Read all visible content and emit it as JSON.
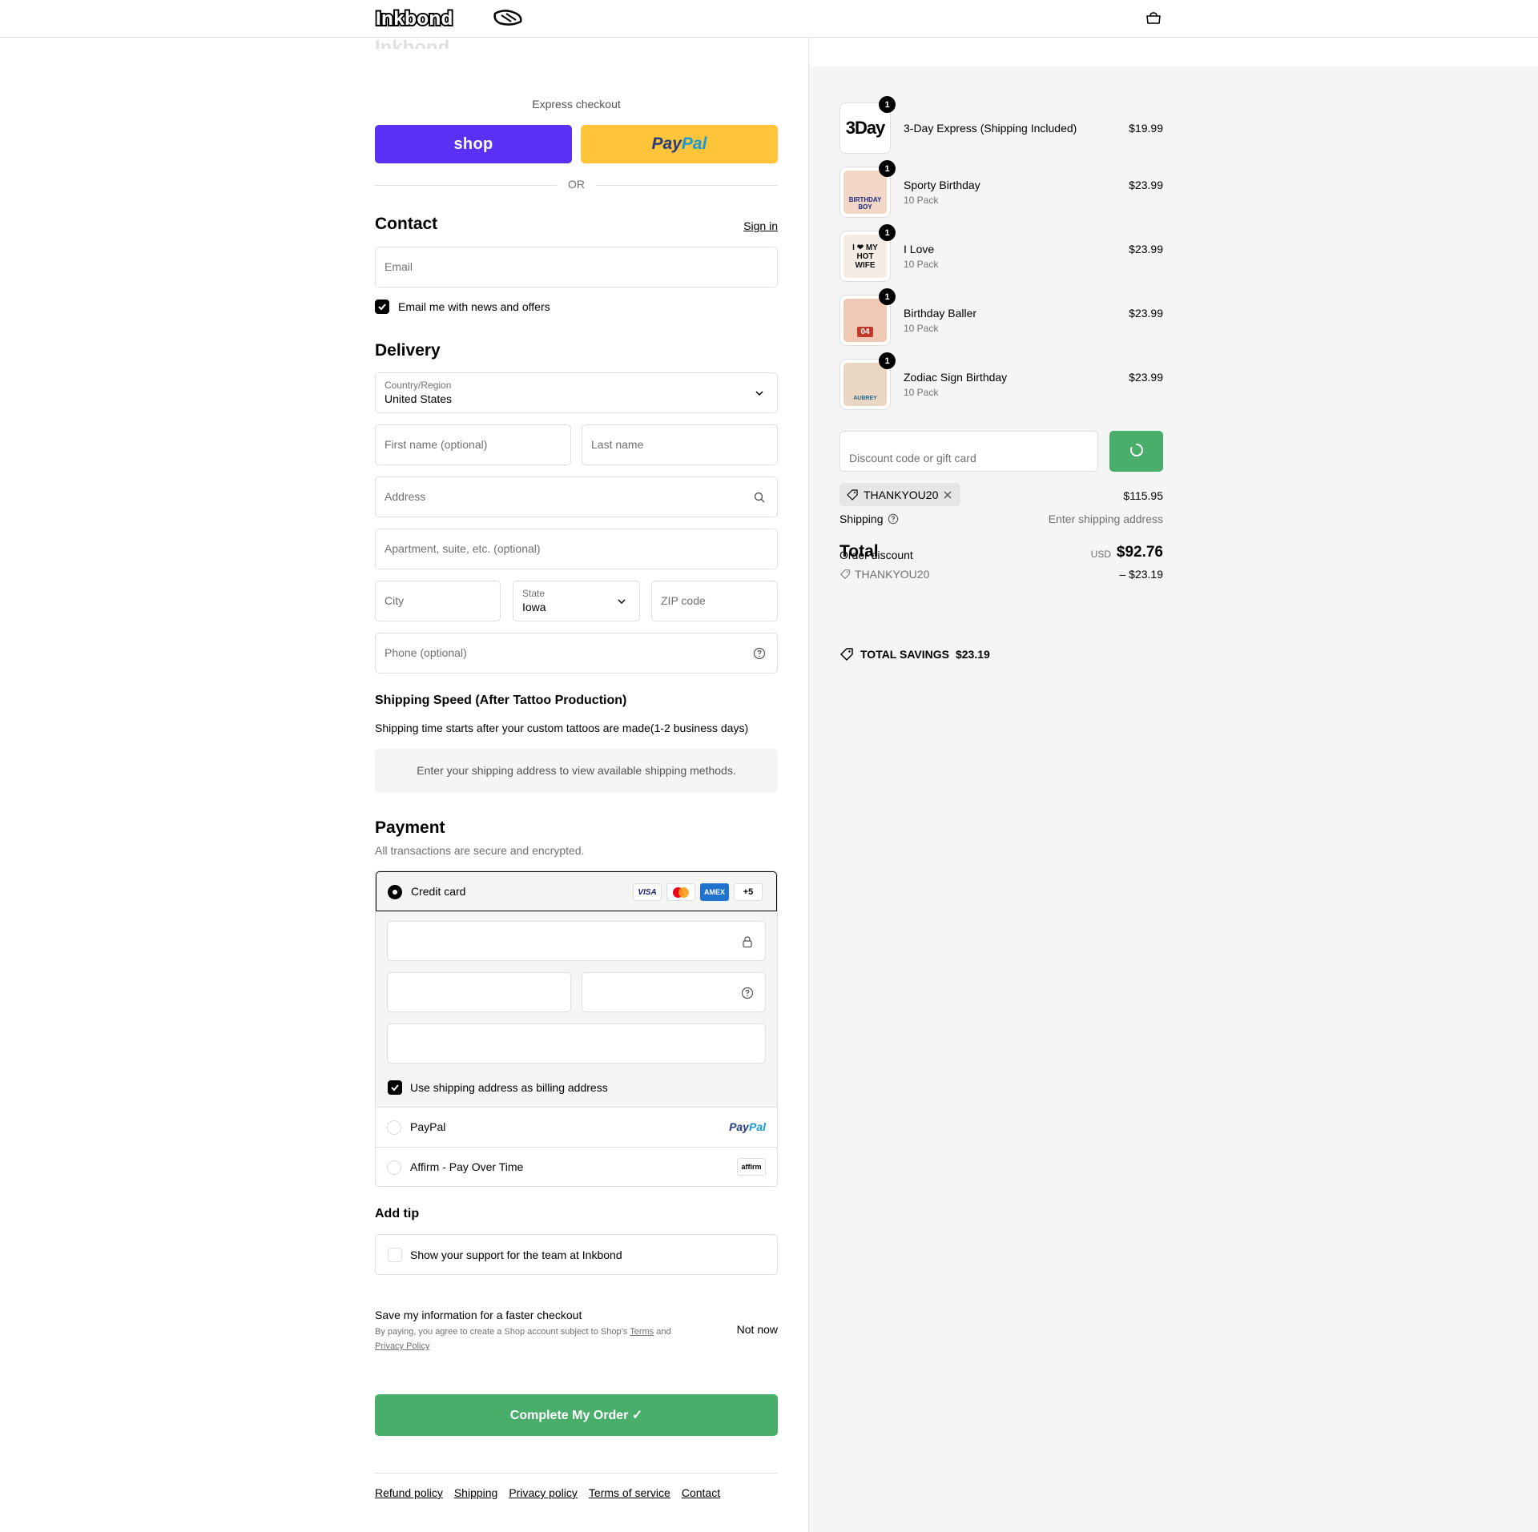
{
  "header": {
    "logo_text": "Inkbond",
    "cart_icon": "cart-icon"
  },
  "express": {
    "label": "Express checkout",
    "shop_label": "shop",
    "paypal_label_a": "Pay",
    "paypal_label_b": "Pal",
    "or_label": "OR"
  },
  "contact": {
    "title": "Contact",
    "sign_in": "Sign in",
    "email_placeholder": "Email",
    "news_label": "Email me with news and offers",
    "news_checked": true
  },
  "delivery": {
    "title": "Delivery",
    "country_label": "Country/Region",
    "country_value": "United States",
    "first_name_placeholder": "First name (optional)",
    "last_name_placeholder": "Last name",
    "address_placeholder": "Address",
    "apartment_placeholder": "Apartment, suite, etc. (optional)",
    "city_placeholder": "City",
    "state_label": "State",
    "state_value": "Iowa",
    "zip_placeholder": "ZIP code",
    "phone_placeholder": "Phone (optional)"
  },
  "shipping_speed": {
    "title": "Shipping Speed (After Tattoo Production)",
    "description": "Shipping time starts after your custom tattoos are made(1-2 business days)",
    "notice": "Enter your shipping address to view available shipping methods."
  },
  "payment": {
    "title": "Payment",
    "subtitle": "All transactions are secure and encrypted.",
    "credit_card_label": "Credit card",
    "card_logos": [
      "VISA",
      "MC",
      "AMEX",
      "+5"
    ],
    "billing_label": "Use shipping address as billing address",
    "paypal_label": "PayPal",
    "paypal_logo_a": "Pay",
    "paypal_logo_b": "Pal",
    "affirm_label": "Affirm - Pay Over Time",
    "affirm_logo": "affirm"
  },
  "tip": {
    "title": "Add tip",
    "label": "Show your support for the team at Inkbond"
  },
  "save_info": {
    "title": "Save my information for a faster checkout",
    "desc_a": "By paying, you agree to create a Shop account subject to Shop’s ",
    "terms": "Terms",
    "desc_b": " and ",
    "privacy": "Privacy Policy",
    "not_now": "Not now"
  },
  "complete_button": "Complete My Order ✓",
  "footer": {
    "links": [
      "Refund policy",
      "Shipping",
      "Privacy policy",
      "Terms of service",
      "Contact"
    ]
  },
  "summary": {
    "items": [
      {
        "name": "3-Day Express (Shipping Included)",
        "variant": "",
        "price": "$19.99",
        "qty": "1",
        "thumb": "3Day"
      },
      {
        "name": "Sporty Birthday",
        "variant": "10 Pack",
        "price": "$23.99",
        "qty": "1",
        "thumb": "BIRTHDAY BOY"
      },
      {
        "name": "I Love",
        "variant": "10 Pack",
        "price": "$23.99",
        "qty": "1",
        "thumb": "I ❤ MY HOT WIFE"
      },
      {
        "name": "Birthday Baller",
        "variant": "10 Pack",
        "price": "$23.99",
        "qty": "1",
        "thumb": "04"
      },
      {
        "name": "Zodiac Sign Birthday",
        "variant": "10 Pack",
        "price": "$23.99",
        "qty": "1",
        "thumb": "AUBREY"
      }
    ],
    "discount_placeholder": "Discount code or gift card",
    "applied_code": "THANKYOU20",
    "subtotal": "$115.95",
    "shipping_label": "Shipping",
    "shipping_value": "Enter shipping address",
    "total_label": "Total",
    "order_discount_label": "Order discount",
    "currency": "USD",
    "total_value": "$92.76",
    "discount_code": "THANKYOU20",
    "discount_amount": "– $23.19",
    "savings_label": "TOTAL SAVINGS",
    "savings_value": "$23.19"
  },
  "colors": {
    "shop_purple": "#5a31f4",
    "paypal_yellow": "#ffc439",
    "accent_green": "#4aae6b"
  }
}
